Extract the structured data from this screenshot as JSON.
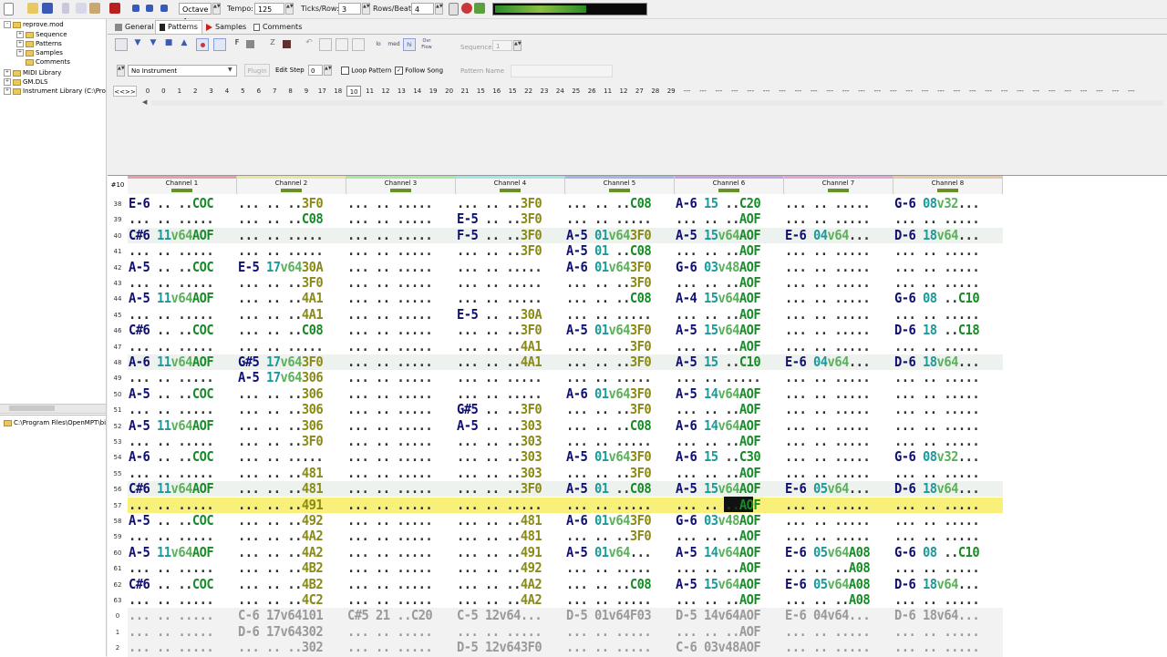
{
  "toolbar": {
    "octave": "Octave 4",
    "tempo_label": "Tempo:",
    "tempo": "125",
    "ticks_label": "Ticks/Row:",
    "ticks": "3",
    "rows_label": "Rows/Beat:",
    "rows": "4"
  },
  "tree": {
    "root": "reprove.mod",
    "children": [
      "Sequence",
      "Patterns",
      "Samples",
      "Comments"
    ],
    "libs": [
      "MIDI Library",
      "GM.DLS",
      "Instrument Library (C:\\Progr"
    ],
    "path": "C:\\Program Files\\OpenMPT\\bi"
  },
  "tabs": [
    "General",
    "Patterns",
    "Samples",
    "Comments"
  ],
  "controls": {
    "sequence_label": "Sequence",
    "sequence_val": "1",
    "instrument": "No Instrument",
    "plugin": "Plugin",
    "edit_step_label": "Edit Step",
    "edit_step": "0",
    "loop_pattern": "Loop Pattern",
    "follow_song": "Follow Song",
    "pattern_name": "Pattern Name",
    "tool_labels": [
      "lo",
      "med",
      "hi"
    ],
    "overflow_label": "Ovr Flow"
  },
  "sequence": {
    "prev": "<<",
    "next": ">>",
    "items": [
      "0",
      "0",
      "1",
      "2",
      "3",
      "4",
      "5",
      "6",
      "7",
      "8",
      "9",
      "17",
      "18",
      "10",
      "11",
      "12",
      "13",
      "14",
      "19",
      "20",
      "21",
      "15",
      "16",
      "15",
      "22",
      "23",
      "24",
      "25",
      "26",
      "11",
      "12",
      "27",
      "28",
      "29",
      "---",
      "---",
      "---",
      "---",
      "---",
      "---",
      "---",
      "---",
      "---",
      "---",
      "---",
      "---",
      "---",
      "---",
      "---",
      "---",
      "---",
      "---",
      "---",
      "---",
      "---",
      "---",
      "---",
      "---",
      "---",
      "---",
      "---",
      "---",
      "---"
    ],
    "current_index": 13
  },
  "pattern": {
    "row_header": "#10",
    "channels": [
      {
        "name": "Channel 1",
        "color": "#e8a0a8"
      },
      {
        "name": "Channel 2",
        "color": "#e8e8a0"
      },
      {
        "name": "Channel 3",
        "color": "#a8e8a0"
      },
      {
        "name": "Channel 4",
        "color": "#a0e8e8"
      },
      {
        "name": "Channel 5",
        "color": "#a0b8e8"
      },
      {
        "name": "Channel 6",
        "color": "#c8a0e8"
      },
      {
        "name": "Channel 7",
        "color": "#e8a0d8"
      },
      {
        "name": "Channel 8",
        "color": "#e8c8a0"
      }
    ],
    "rows": [
      {
        "n": "38",
        "c": [
          "E-6 .. ..COC",
          "... .. ..3F0",
          "... .. .....",
          "... .. ..3F0",
          "... .. ..C08",
          "A-6 15 ..C20",
          "... .. .....",
          "G-6 08v32..."
        ]
      },
      {
        "n": "39",
        "c": [
          "... .. .....",
          "... .. ..C08",
          "... .. .....",
          "E-5 .. ..3F0",
          "... .. .....",
          "... .. ..AOF",
          "... .. .....",
          "... .. ....."
        ]
      },
      {
        "n": "40",
        "c": [
          "C#6 11v64AOF",
          "... .. .....",
          "... .. .....",
          "F-5 .. ..3F0",
          "A-5 01v643F0",
          "A-5 15v64AOF",
          "E-6 04v64...",
          "D-6 18v64..."
        ]
      },
      {
        "n": "41",
        "c": [
          "... .. .....",
          "... .. .....",
          "... .. .....",
          "... .. ..3F0",
          "A-5 01 ..C08",
          "... .. ..AOF",
          "... .. .....",
          "... .. ....."
        ]
      },
      {
        "n": "42",
        "c": [
          "A-5 .. ..COC",
          "E-5 17v6430A",
          "... .. .....",
          "... .. .....",
          "A-6 01v643F0",
          "G-6 03v48AOF",
          "... .. .....",
          "... .. ....."
        ]
      },
      {
        "n": "43",
        "c": [
          "... .. .....",
          "... .. ..3F0",
          "... .. .....",
          "... .. .....",
          "... .. ..3F0",
          "... .. ..AOF",
          "... .. .....",
          "... .. ....."
        ]
      },
      {
        "n": "44",
        "c": [
          "A-5 11v64AOF",
          "... .. ..4A1",
          "... .. .....",
          "... .. .....",
          "... .. ..C08",
          "A-4 15v64AOF",
          "... .. .....",
          "G-6 08 ..C10"
        ]
      },
      {
        "n": "45",
        "c": [
          "... .. .....",
          "... .. ..4A1",
          "... .. .....",
          "E-5 .. ..30A",
          "... .. .....",
          "... .. ..AOF",
          "... .. .....",
          "... .. ....."
        ]
      },
      {
        "n": "46",
        "c": [
          "C#6 .. ..COC",
          "... .. ..C08",
          "... .. .....",
          "... .. ..3F0",
          "A-5 01v643F0",
          "A-5 15v64AOF",
          "... .. .....",
          "D-6 18 ..C18"
        ]
      },
      {
        "n": "47",
        "c": [
          "... .. .....",
          "... .. .....",
          "... .. .....",
          "... .. ..4A1",
          "... .. ..3F0",
          "... .. ..AOF",
          "... .. .....",
          "... .. ....."
        ]
      },
      {
        "n": "48",
        "c": [
          "A-6 11v64AOF",
          "G#5 17v643F0",
          "... .. .....",
          "... .. ..4A1",
          "... .. ..3F0",
          "A-5 15 ..C10",
          "E-6 04v64...",
          "D-6 18v64..."
        ]
      },
      {
        "n": "49",
        "c": [
          "... .. .....",
          "A-5 17v64306",
          "... .. .....",
          "... .. .....",
          "... .. .....",
          "... .. .....",
          "... .. .....",
          "... .. ....."
        ]
      },
      {
        "n": "50",
        "c": [
          "A-5 .. ..COC",
          "... .. ..306",
          "... .. .....",
          "... .. .....",
          "A-6 01v643F0",
          "A-5 14v64AOF",
          "... .. .....",
          "... .. ....."
        ]
      },
      {
        "n": "51",
        "c": [
          "... .. .....",
          "... .. ..306",
          "... .. .....",
          "G#5 .. ..3F0",
          "... .. ..3F0",
          "... .. ..AOF",
          "... .. .....",
          "... .. ....."
        ]
      },
      {
        "n": "52",
        "c": [
          "A-5 11v64AOF",
          "... .. ..306",
          "... .. .....",
          "A-5 .. ..303",
          "... .. ..C08",
          "A-6 14v64AOF",
          "... .. .....",
          "... .. ....."
        ]
      },
      {
        "n": "53",
        "c": [
          "... .. .....",
          "... .. ..3F0",
          "... .. .....",
          "... .. ..303",
          "... .. .....",
          "... .. ..AOF",
          "... .. .....",
          "... .. ....."
        ]
      },
      {
        "n": "54",
        "c": [
          "A-6 .. ..COC",
          "... .. .....",
          "... .. .....",
          "... .. ..303",
          "A-5 01v643F0",
          "A-6 15 ..C30",
          "... .. .....",
          "G-6 08v32..."
        ]
      },
      {
        "n": "55",
        "c": [
          "... .. .....",
          "... .. ..481",
          "... .. .....",
          "... .. ..303",
          "... .. ..3F0",
          "... .. ..AOF",
          "... .. .....",
          "... .. ....."
        ]
      },
      {
        "n": "56",
        "c": [
          "C#6 11v64AOF",
          "... .. ..481",
          "... .. .....",
          "... .. ..3F0",
          "A-5 01 ..C08",
          "A-5 15v64AOF",
          "E-6 05v64...",
          "D-6 18v64..."
        ]
      },
      {
        "n": "57",
        "c": [
          "... .. .....",
          "... .. ..491",
          "... .. .....",
          "... .. .....",
          "... .. .....",
          "... .. ..AOF",
          "... .. .....",
          "... .. ....."
        ]
      },
      {
        "n": "58",
        "c": [
          "A-5 .. ..COC",
          "... .. ..492",
          "... .. .....",
          "... .. ..481",
          "A-6 01v643F0",
          "G-6 03v48AOF",
          "... .. .....",
          "... .. ....."
        ]
      },
      {
        "n": "59",
        "c": [
          "... .. .....",
          "... .. ..4A2",
          "... .. .....",
          "... .. ..481",
          "... .. ..3F0",
          "... .. ..AOF",
          "... .. .....",
          "... .. ....."
        ]
      },
      {
        "n": "60",
        "c": [
          "A-5 11v64AOF",
          "... .. ..4A2",
          "... .. .....",
          "... .. ..491",
          "A-5 01v64...",
          "A-5 14v64AOF",
          "E-6 05v64A08",
          "G-6 08 ..C10"
        ]
      },
      {
        "n": "61",
        "c": [
          "... .. .....",
          "... .. ..4B2",
          "... .. .....",
          "... .. ..492",
          "... .. .....",
          "... .. ..AOF",
          "... .. ..A08",
          "... .. ....."
        ]
      },
      {
        "n": "62",
        "c": [
          "C#6 .. ..COC",
          "... .. ..4B2",
          "... .. .....",
          "... .. ..4A2",
          "... .. ..C08",
          "A-5 15v64AOF",
          "E-6 05v64A08",
          "D-6 18v64..."
        ]
      },
      {
        "n": "63",
        "c": [
          "... .. .....",
          "... .. ..4C2",
          "... .. .....",
          "... .. ..4A2",
          "... .. .....",
          "... .. ..AOF",
          "... .. ..A08",
          "... .. ....."
        ]
      },
      {
        "n": "0",
        "c": [
          "... .. .....",
          "C-6 17v64101",
          "C#5 21 ..C20",
          "C-5 12v64...",
          "D-5 01v64F03",
          "D-5 14v64AOF",
          "E-6 04v64...",
          "D-6 18v64..."
        ]
      },
      {
        "n": "1",
        "c": [
          "... .. .....",
          "D-6 17v64302",
          "... .. .....",
          "... .. .....",
          "... .. .....",
          "... .. ..AOF",
          "... .. .....",
          "... .. ....."
        ]
      },
      {
        "n": "2",
        "c": [
          "... .. .....",
          "... .. ..302",
          "... .. .....",
          "D-5 12v643F0",
          "... .. .....",
          "C-6 03v48AOF",
          "... .. .....",
          "... .. ....."
        ]
      }
    ]
  }
}
